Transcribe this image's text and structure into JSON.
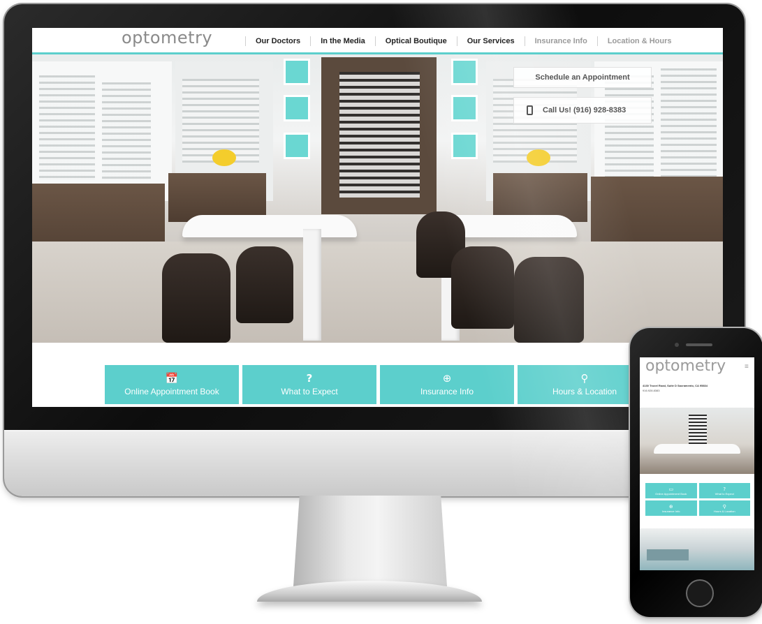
{
  "desktop": {
    "logo": "optometry",
    "nav": [
      {
        "label": "Our Doctors"
      },
      {
        "label": "In the Media"
      },
      {
        "label": "Optical Boutique"
      },
      {
        "label": "Our Services"
      },
      {
        "label": "Insurance Info"
      },
      {
        "label": "Location & Hours"
      }
    ],
    "cta": {
      "schedule": "Schedule an Appointment",
      "call": "Call Us! (916) 928-8383"
    },
    "tiles": [
      {
        "label": "Online Appointment Book",
        "icon": "calendar-icon",
        "glyph": "📅"
      },
      {
        "label": "What to Expect",
        "icon": "question-icon",
        "glyph": "?"
      },
      {
        "label": "Insurance Info",
        "icon": "lifebuoy-icon",
        "glyph": "⊕"
      },
      {
        "label": "Hours & Location",
        "icon": "map-pin-icon",
        "glyph": "⚲"
      }
    ]
  },
  "mobile": {
    "logo": "optometry",
    "menu_glyph": "≡",
    "address": "4130 Truxel Road, Suite D Sacramento, CA 95834",
    "phone": "916.928.8383",
    "tiles": [
      {
        "label": "Online Appointment Book",
        "icon": "calendar-icon",
        "glyph": "▭"
      },
      {
        "label": "What to Expect",
        "icon": "question-icon",
        "glyph": "?"
      },
      {
        "label": "Insurance Info",
        "icon": "lifebuoy-icon",
        "glyph": "⊕"
      },
      {
        "label": "Hours & Location",
        "icon": "map-pin-icon",
        "glyph": "⚲"
      }
    ]
  },
  "colors": {
    "accent": "#5ccfcc",
    "text_dark": "#222222",
    "text_muted": "#9a9a9a"
  }
}
